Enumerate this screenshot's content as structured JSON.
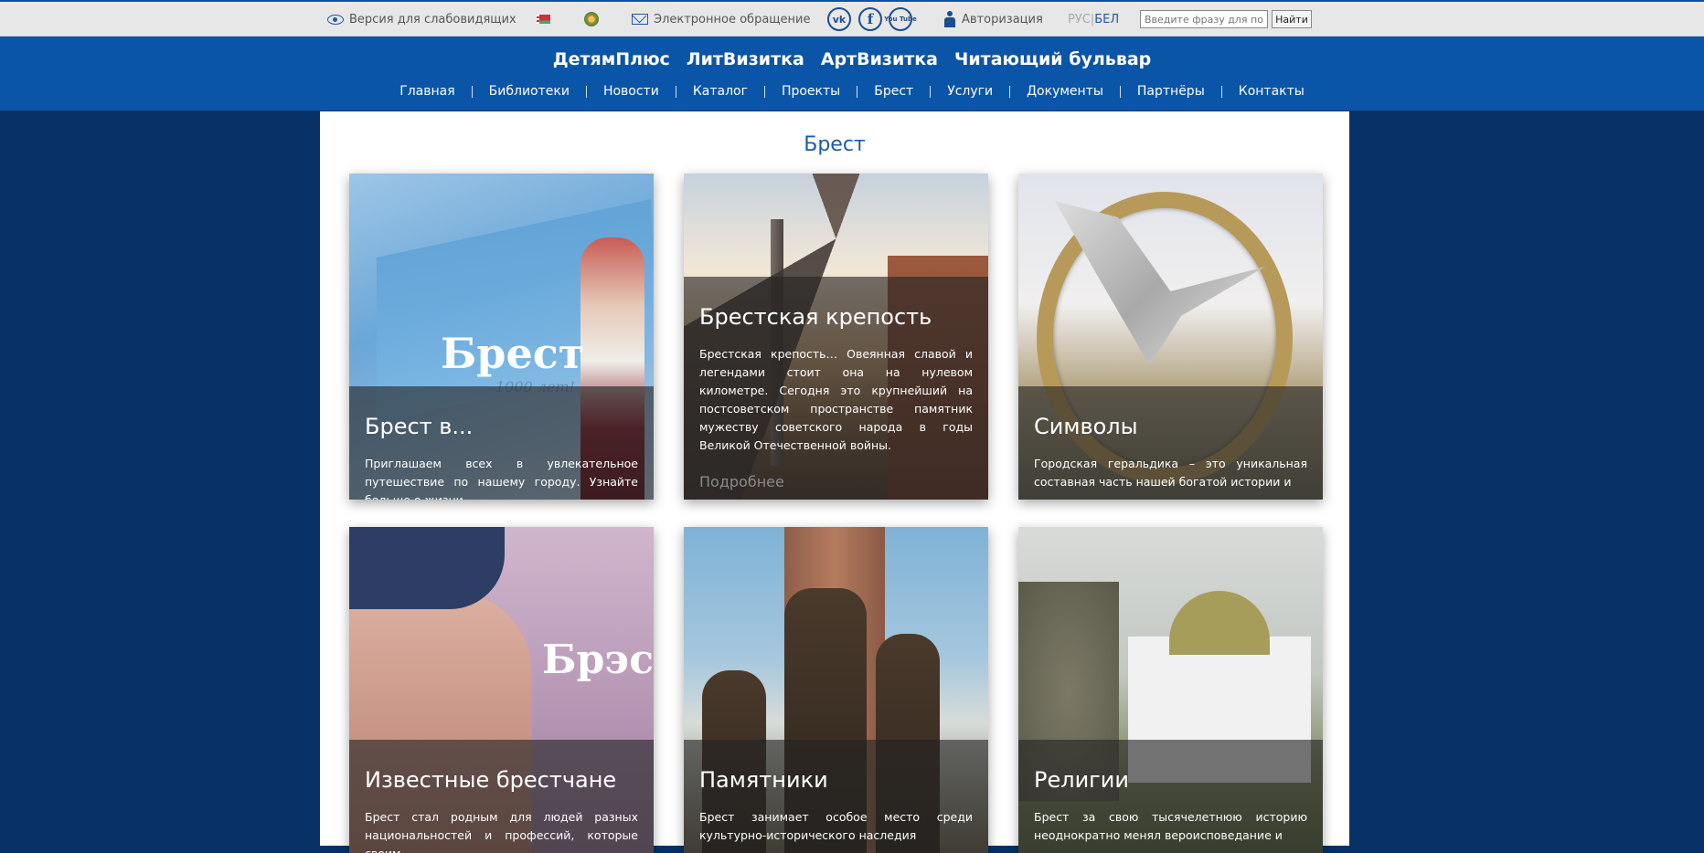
{
  "topbar": {
    "low_vision": "Версия для слабовидящих",
    "e_appeal": "Электронное обращение",
    "social": {
      "vk": "vk",
      "facebook": "f",
      "youtube": "You Tube"
    },
    "auth": "Авторизация",
    "lang_ru": "РУС",
    "lang_sep": "|",
    "lang_be": "БЕЛ",
    "search_placeholder": "Введите фразу для поис",
    "search_button": "Найти"
  },
  "projects": [
    "ДетямПлюс",
    "ЛитВизитка",
    "АртВизитка",
    "Читающий бульвар"
  ],
  "nav": [
    "Главная",
    "Библиотеки",
    "Новости",
    "Каталог",
    "Проекты",
    "Брест",
    "Услуги",
    "Документы",
    "Партнёры",
    "Контакты"
  ],
  "page": {
    "title": "Брест"
  },
  "cards": [
    {
      "title": "Брест в...",
      "text": "Приглашаем всех в увлекательное путешествие по нашему городу. Узнайте больше о жизни",
      "logo": "Брест",
      "logo_sub": "1000 лет!"
    },
    {
      "title": "Брестская крепость",
      "text": "Брестская крепость… Овеянная славой и легендами стоит она на нулевом километре. Сегодня это крупнейший на постсоветском пространстве памятник мужеству советского народа в годы Великой Отечественной войны.",
      "more": "Подробнее"
    },
    {
      "title": "Символы",
      "text": "Городская геральдика – это уникальная составная часть нашей богатой истории и"
    },
    {
      "title": "Известные брестчане",
      "text": "Брест стал родным для людей разных национальностей и профессий, которые своим",
      "logo": "Брэс"
    },
    {
      "title": "Памятники",
      "text": "Брест занимает особое место среди культурно-исторического наследия"
    },
    {
      "title": "Религии",
      "text": "Брест за свою тысячелетнюю историю неоднократно менял вероисповедание и"
    }
  ],
  "colors": {
    "header": "#0b55a8",
    "background": "#073166",
    "title": "#1a5ca8"
  }
}
